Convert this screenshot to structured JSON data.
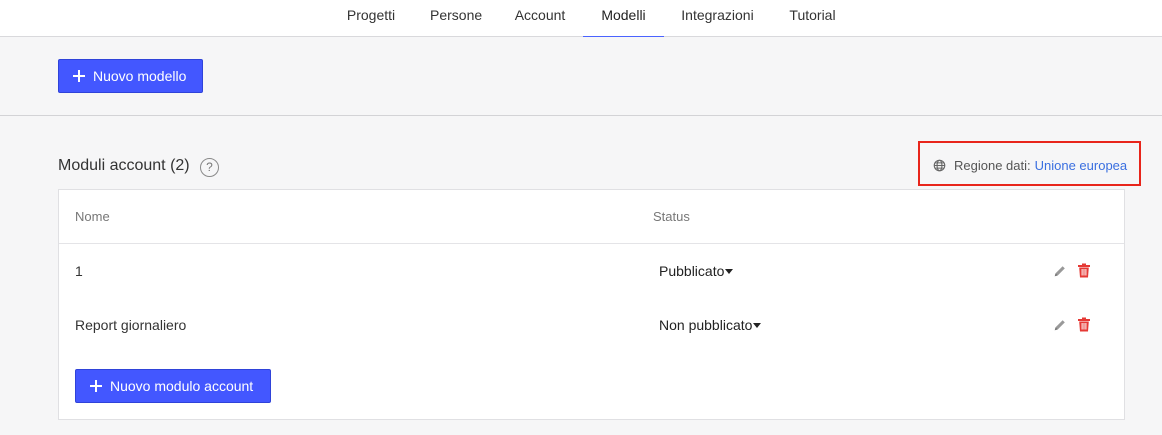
{
  "nav": {
    "tabs": [
      {
        "label": "Progetti"
      },
      {
        "label": "Persone"
      },
      {
        "label": "Account"
      },
      {
        "label": "Modelli",
        "active": true
      },
      {
        "label": "Integrazioni"
      },
      {
        "label": "Tutorial"
      }
    ]
  },
  "toolbar": {
    "new_template_label": "Nuovo modello"
  },
  "section": {
    "title": "Moduli account (2)",
    "help_symbol": "?",
    "region_label": "Regione dati:",
    "region_value": "Unione europea"
  },
  "table": {
    "columns": [
      "Nome",
      "Status"
    ],
    "rows": [
      {
        "name": "1",
        "status": "Pubblicato"
      },
      {
        "name": "Report giornaliero",
        "status": "Non pubblicato"
      }
    ],
    "new_form_label": "Nuovo modulo account"
  },
  "colors": {
    "accent": "#4357ff",
    "link": "#3a6fe0",
    "danger": "#e53935",
    "highlight": "#e8251b"
  },
  "icons": [
    "plus-icon",
    "question-icon",
    "globe-icon",
    "pencil-icon",
    "trash-icon",
    "caret-down-icon"
  ]
}
